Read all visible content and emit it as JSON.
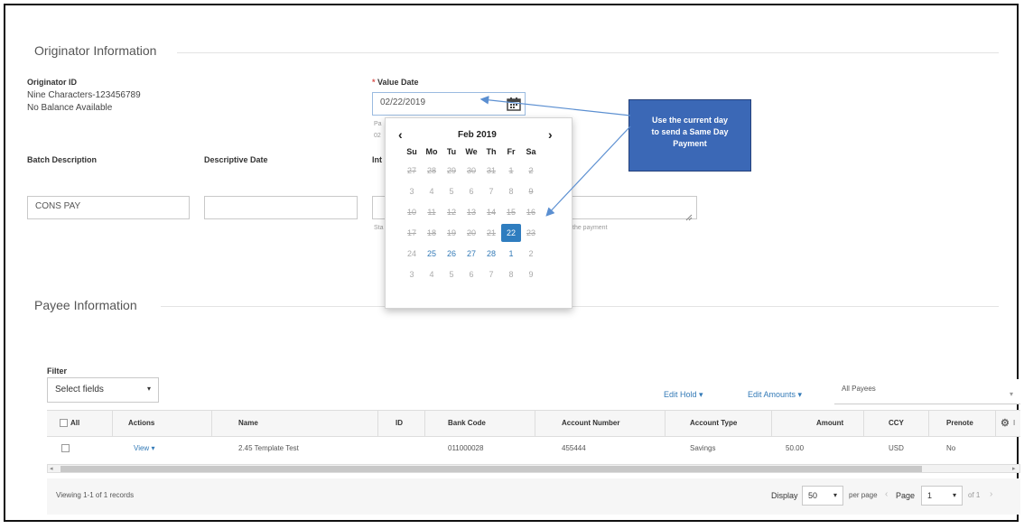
{
  "originator": {
    "section_title": "Originator Information",
    "id_label": "Originator ID",
    "id_value": "Nine Characters-123456789",
    "balance": "No Balance Available"
  },
  "value_date": {
    "required_mark": "*",
    "label": "Value Date",
    "value": "02/22/2019",
    "hint_line1": "Pa",
    "hint_line2": "02"
  },
  "calendar": {
    "prev": "‹",
    "next": "›",
    "month": "Feb 2019",
    "dow": [
      "Su",
      "Mo",
      "Tu",
      "We",
      "Th",
      "Fr",
      "Sa"
    ],
    "weeks": [
      [
        {
          "d": "27",
          "s": "past"
        },
        {
          "d": "28",
          "s": "past"
        },
        {
          "d": "29",
          "s": "past"
        },
        {
          "d": "30",
          "s": "past"
        },
        {
          "d": "31",
          "s": "past"
        },
        {
          "d": "1",
          "s": "past"
        },
        {
          "d": "2",
          "s": "past"
        }
      ],
      [
        {
          "d": "3",
          "s": "other"
        },
        {
          "d": "4",
          "s": "other"
        },
        {
          "d": "5",
          "s": "other"
        },
        {
          "d": "6",
          "s": "other"
        },
        {
          "d": "7",
          "s": "other"
        },
        {
          "d": "8",
          "s": "other"
        },
        {
          "d": "9",
          "s": "past"
        }
      ],
      [
        {
          "d": "10",
          "s": "past"
        },
        {
          "d": "11",
          "s": "past"
        },
        {
          "d": "12",
          "s": "past"
        },
        {
          "d": "13",
          "s": "past"
        },
        {
          "d": "14",
          "s": "past"
        },
        {
          "d": "15",
          "s": "past"
        },
        {
          "d": "16",
          "s": "past"
        }
      ],
      [
        {
          "d": "17",
          "s": "past"
        },
        {
          "d": "18",
          "s": "past"
        },
        {
          "d": "19",
          "s": "past"
        },
        {
          "d": "20",
          "s": "past"
        },
        {
          "d": "21",
          "s": "past"
        },
        {
          "d": "22",
          "s": "sel"
        },
        {
          "d": "23",
          "s": "past"
        }
      ],
      [
        {
          "d": "24",
          "s": "other"
        },
        {
          "d": "25",
          "s": "future"
        },
        {
          "d": "26",
          "s": "future"
        },
        {
          "d": "27",
          "s": "future"
        },
        {
          "d": "28",
          "s": "future"
        },
        {
          "d": "1",
          "s": "future"
        },
        {
          "d": "2",
          "s": "other"
        }
      ],
      [
        {
          "d": "3",
          "s": "other"
        },
        {
          "d": "4",
          "s": "other"
        },
        {
          "d": "5",
          "s": "other"
        },
        {
          "d": "6",
          "s": "other"
        },
        {
          "d": "7",
          "s": "other"
        },
        {
          "d": "8",
          "s": "other"
        },
        {
          "d": "9",
          "s": "other"
        }
      ]
    ]
  },
  "callout": {
    "line1": "Use the current day",
    "line2": "to send  a Same Day",
    "line3": "Payment"
  },
  "batch": {
    "desc_label": "Batch Description",
    "desc_value": "CONS PAY",
    "descriptive_date_label": "Descriptive Date",
    "descriptive_date_value": "",
    "int_label": "Int",
    "int_hint_prefix": "Sta",
    "int_hint_suffix": "the payment"
  },
  "payee": {
    "section_title": "Payee Information",
    "filter_label": "Filter",
    "filter_select": "Select fields",
    "edit_hold": "Edit Hold",
    "edit_amounts": "Edit Amounts",
    "all_payees": "All Payees",
    "columns": {
      "all": "All",
      "actions": "Actions",
      "name": "Name",
      "id": "ID",
      "bank_code": "Bank Code",
      "account_number": "Account Number",
      "account_type": "Account Type",
      "amount": "Amount",
      "ccy": "CCY",
      "prenote": "Prenote",
      "settings_trail": "I"
    },
    "row": {
      "action": "View",
      "name": "2.45 Template Test",
      "id": "",
      "bank_code": "011000028",
      "account_number": "455444",
      "account_type": "Savings",
      "amount": "50.00",
      "ccy": "USD",
      "prenote": "No"
    },
    "records_text": "Viewing 1-1 of 1 records",
    "display_label": "Display",
    "per_page_value": "50",
    "per_page_label": "per page",
    "page_label": "Page",
    "page_value": "1",
    "of_label": "of 1"
  },
  "colors": {
    "accent": "#337ab7",
    "callout": "#3b68b6",
    "selected_day": "#2f7dbf"
  }
}
